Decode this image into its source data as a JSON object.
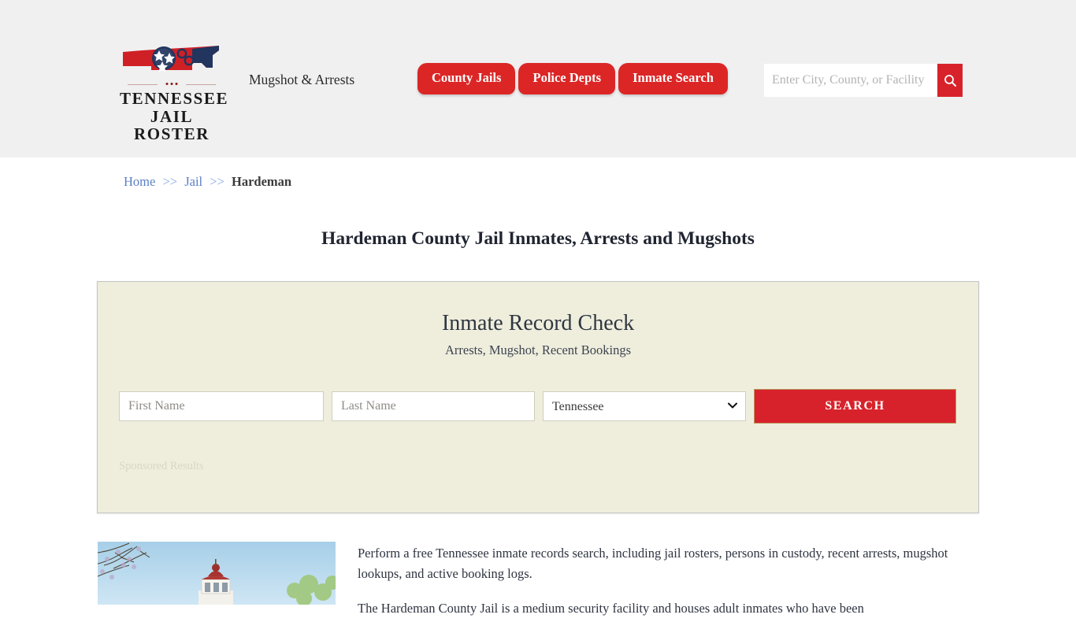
{
  "header": {
    "logo": {
      "line1": "TENNESSEE",
      "line2": "JAIL ROSTER",
      "icon": "tennessee-state-handcuffs-logo"
    },
    "tagline": "Mugshot & Arrests",
    "nav": [
      {
        "label": "County Jails"
      },
      {
        "label": "Police Depts"
      },
      {
        "label": "Inmate Search"
      }
    ],
    "search": {
      "placeholder": "Enter City, County, or Facility",
      "value": "",
      "button_icon": "search-icon"
    }
  },
  "breadcrumb": {
    "home": "Home",
    "sep1": ">>",
    "jail": "Jail",
    "sep2": ">>",
    "current": "Hardeman"
  },
  "page_title": "Hardeman County Jail Inmates, Arrests and Mugshots",
  "panel": {
    "title": "Inmate Record Check",
    "subtitle": "Arrests, Mugshot, Recent Bookings",
    "form": {
      "first_name_placeholder": "First Name",
      "first_name_value": "",
      "last_name_placeholder": "Last Name",
      "last_name_value": "",
      "state_selected": "Tennessee",
      "state_options": [
        "Tennessee"
      ],
      "search_button": "SEARCH"
    },
    "sponsored_label": "Sponsored Results"
  },
  "content": {
    "image_alt": "hardeman-county-courthouse-photo",
    "paragraph1": "Perform a free Tennessee inmate records search, including jail rosters, persons in custody, recent arrests, mugshot lookups, and active booking logs.",
    "paragraph2": "The Hardeman County Jail is a medium security facility and houses adult inmates who have been"
  },
  "colors": {
    "brand_red": "#d8222b",
    "nav_red": "#dc2626",
    "header_bg": "#f0f0f0",
    "panel_bg": "#efeedd",
    "link_blue": "#5b7fc7"
  }
}
